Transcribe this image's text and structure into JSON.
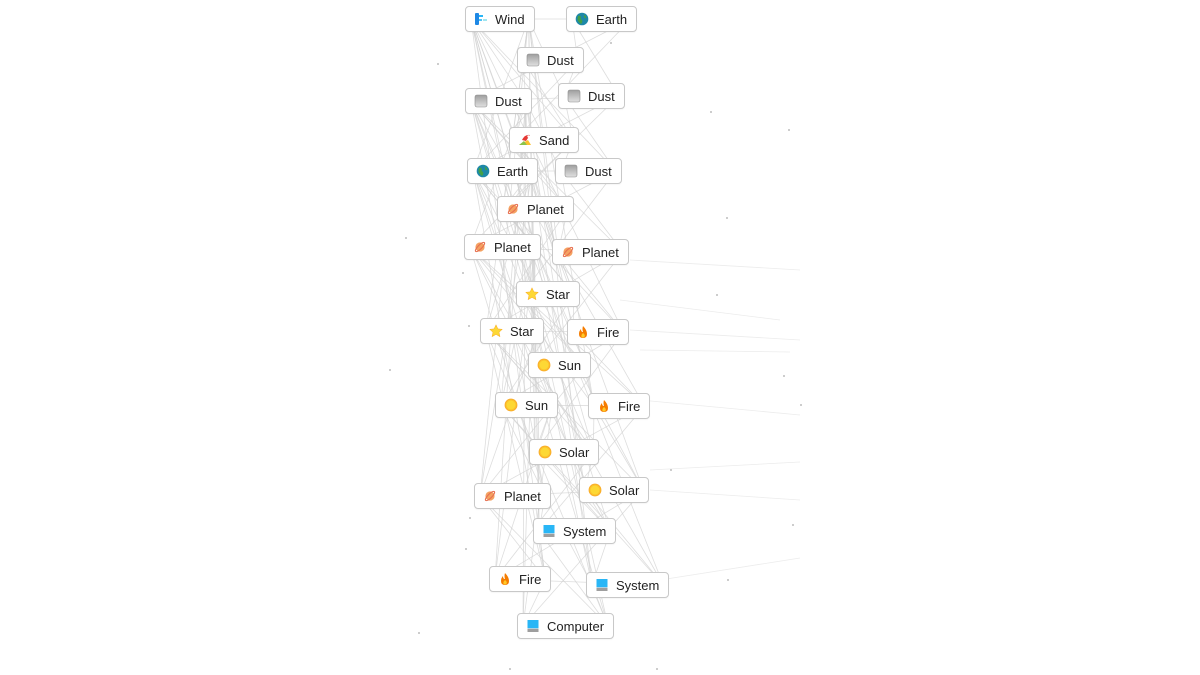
{
  "canvas": {
    "background": "#ffffff",
    "edge_color": "#d2d2d2",
    "node_border": "#c8c8c8"
  },
  "nodes": [
    {
      "label": "Wind",
      "icon": "wind-icon"
    },
    {
      "label": "Earth",
      "icon": "earth-icon"
    },
    {
      "label": "Dust",
      "icon": "dust-icon"
    },
    {
      "label": "Dust",
      "icon": "dust-icon"
    },
    {
      "label": "Dust",
      "icon": "dust-icon"
    },
    {
      "label": "Sand",
      "icon": "sand-icon"
    },
    {
      "label": "Earth",
      "icon": "earth-icon"
    },
    {
      "label": "Dust",
      "icon": "dust-icon"
    },
    {
      "label": "Planet",
      "icon": "planet-icon"
    },
    {
      "label": "Planet",
      "icon": "planet-icon"
    },
    {
      "label": "Planet",
      "icon": "planet-icon"
    },
    {
      "label": "Star",
      "icon": "star-icon"
    },
    {
      "label": "Star",
      "icon": "star-icon"
    },
    {
      "label": "Fire",
      "icon": "fire-icon"
    },
    {
      "label": "Sun",
      "icon": "sun-icon"
    },
    {
      "label": "Sun",
      "icon": "sun-icon"
    },
    {
      "label": "Fire",
      "icon": "fire-icon"
    },
    {
      "label": "Solar",
      "icon": "sun-icon"
    },
    {
      "label": "Planet",
      "icon": "planet-icon"
    },
    {
      "label": "Solar",
      "icon": "sun-icon"
    },
    {
      "label": "System",
      "icon": "computer-icon"
    },
    {
      "label": "Fire",
      "icon": "fire-icon"
    },
    {
      "label": "System",
      "icon": "computer-icon"
    },
    {
      "label": "Computer",
      "icon": "computer-icon"
    }
  ]
}
